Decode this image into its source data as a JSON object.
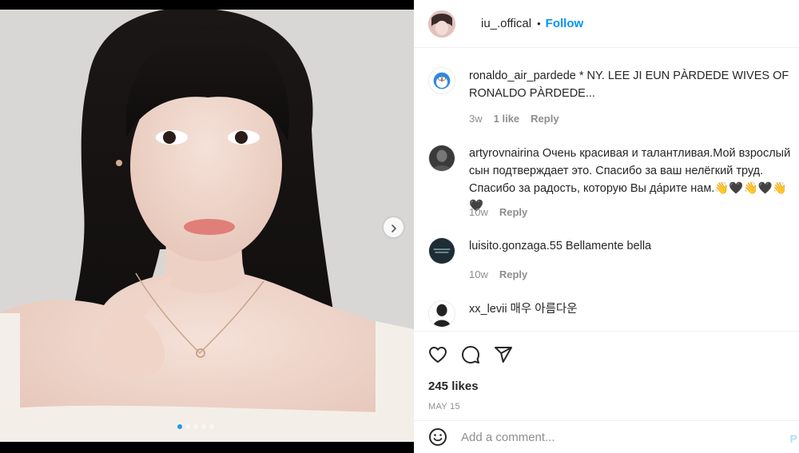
{
  "media": {
    "next_icon": "chevron-right-icon",
    "carousel": {
      "count": 5,
      "active": 0
    }
  },
  "header": {
    "username": "iu_.offical",
    "separator": "•",
    "follow_label": "Follow"
  },
  "comments": [
    {
      "username": "ronaldo_air_pardede",
      "text": "* NY. LEE JI EUN PÀRDEDE WIVES OF RONALDO PÀRDEDE...",
      "time": "3w",
      "likes": "1 like",
      "reply": "Reply"
    },
    {
      "username": "artyrovnairina",
      "text": "Очень красивая и талантливая.Мой взрослый сын подтверждает это. Спасибо за ваш нелёгкий труд. Спасибо за радость, которую Вы дáрите нам.👋🖤👋🖤👋🖤",
      "time": "10w",
      "reply": "Reply"
    },
    {
      "username": "luisito.gonzaga.55",
      "text": "Bellamente bella",
      "time": "10w",
      "reply": "Reply"
    },
    {
      "username": "xx_levii",
      "text": "매우 아름다운"
    }
  ],
  "actions": {
    "like_icon": "heart-icon",
    "comment_icon": "comment-icon",
    "share_icon": "paper-plane-icon",
    "likes": "245 likes",
    "date": "MAY 15"
  },
  "add_comment": {
    "placeholder": "Add a comment...",
    "post_label": "P"
  },
  "colors": {
    "accent": "#0095f6",
    "muted": "#8e8e8e",
    "text": "#262626",
    "divider": "#efefef"
  }
}
